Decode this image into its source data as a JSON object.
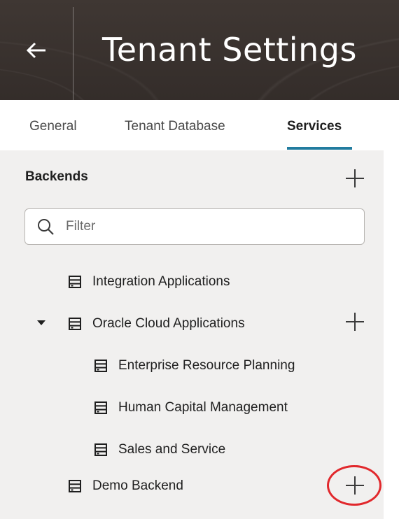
{
  "header": {
    "back_icon": "arrow-left-icon",
    "title": "Tenant Settings"
  },
  "tabs": [
    {
      "label": "General",
      "active": false
    },
    {
      "label": "Tenant Database",
      "active": false
    },
    {
      "label": "Services",
      "active": true
    }
  ],
  "panel": {
    "title": "Backends",
    "add_icon": "plus-icon",
    "filter": {
      "value": "",
      "placeholder": "Filter",
      "icon": "search-icon"
    },
    "tree": [
      {
        "label": "Integration Applications",
        "icon": "server-icon"
      },
      {
        "label": "Oracle Cloud Applications",
        "icon": "server-icon",
        "expanded": true
      },
      {
        "label": "Enterprise Resource Planning",
        "icon": "server-icon"
      },
      {
        "label": "Human Capital Management",
        "icon": "server-icon"
      },
      {
        "label": "Sales and Service",
        "icon": "server-icon"
      },
      {
        "label": "Demo Backend",
        "icon": "server-icon"
      }
    ]
  },
  "colors": {
    "header_bg": "#3b3430",
    "active_tab_underline": "#227c9f",
    "panel_bg": "#f1f0ef",
    "highlight": "#e1282c"
  }
}
